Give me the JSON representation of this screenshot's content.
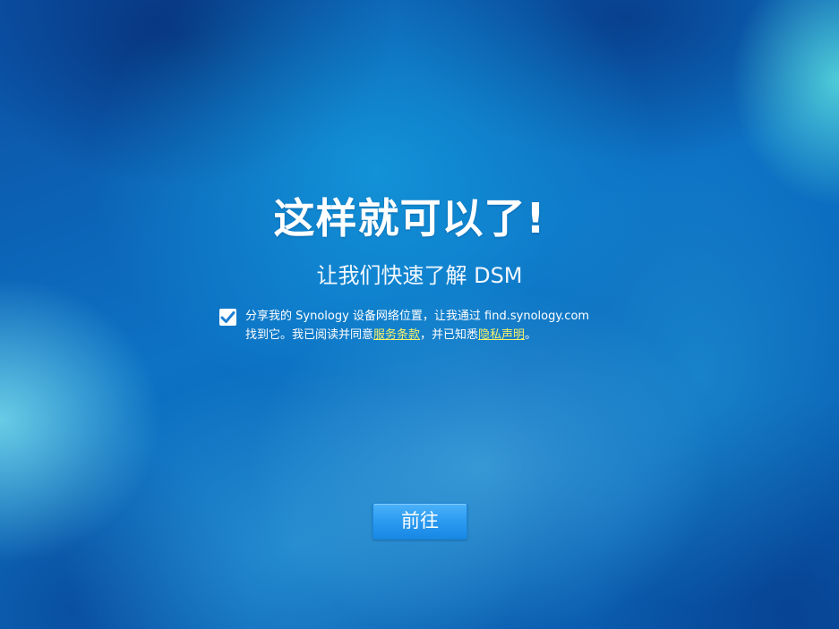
{
  "welcome": {
    "title": "这样就可以了!",
    "subtitle": "让我们快速了解 DSM"
  },
  "consent": {
    "checked": true,
    "text_line1": "分享我的 Synology 设备网络位置，让我通过 find.synology.com",
    "text_line2_prefix": "找到它。我已阅读并同意",
    "terms_link_label": "服务条款",
    "text_middle": "，并已知悉",
    "privacy_link_label": "隐私声明",
    "text_end": "。"
  },
  "actions": {
    "next_label": "前往"
  },
  "colors": {
    "background": "#0b63b5",
    "link": "#f6f36a",
    "button": "#2b9af0",
    "checkmark": "#1a7fd4"
  },
  "icons": {
    "checkbox": "checkmark-icon"
  }
}
